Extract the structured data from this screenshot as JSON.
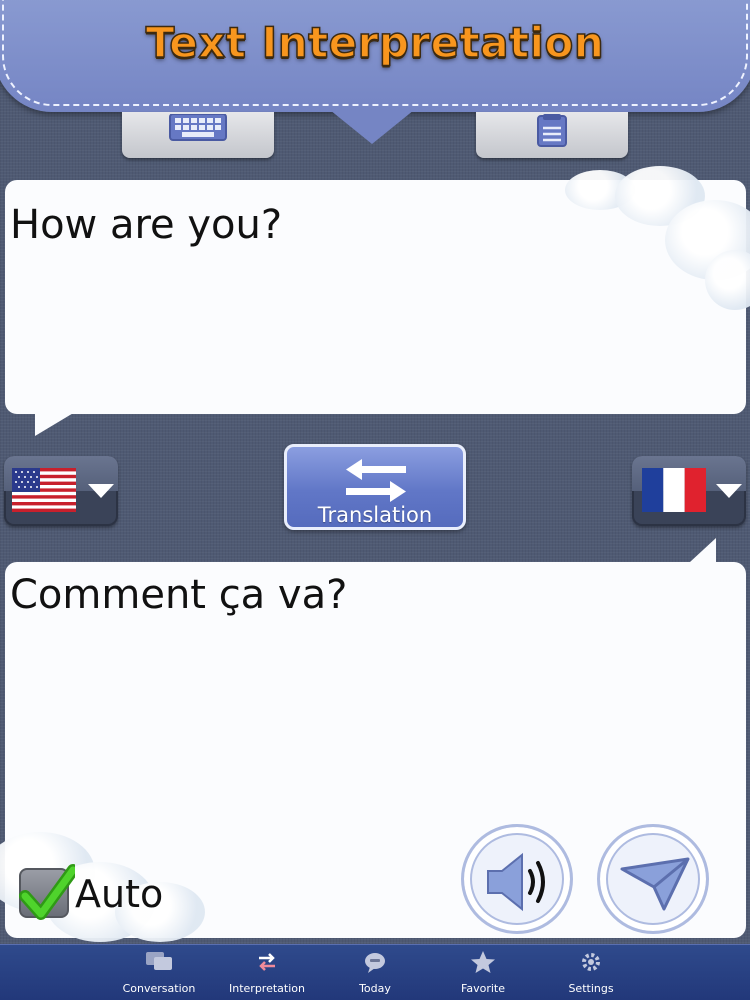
{
  "header": {
    "title": "Text Interpretation"
  },
  "toolbar": {
    "keyboard_icon": "keyboard-icon",
    "paste_icon": "clipboard-icon"
  },
  "source": {
    "text": "How are you?",
    "language_flag": "us-flag-icon"
  },
  "target": {
    "text": "Comment ça va?",
    "language_flag": "france-flag-icon"
  },
  "translate_button": {
    "label": "Translation",
    "icon": "swap-arrows-icon"
  },
  "auto": {
    "label": "Auto",
    "checked": true
  },
  "actions": {
    "speak_icon": "speaker-icon",
    "send_icon": "paper-plane-icon"
  },
  "colors": {
    "title": "#f8961e",
    "banner": "#7f90cc",
    "tabbar": "#2a418a",
    "check": "#38c21e"
  },
  "tabs": [
    {
      "label": "Conversation",
      "icon": "chat-bubbles-icon"
    },
    {
      "label": "Interpretation",
      "icon": "exchange-icon"
    },
    {
      "label": "Today",
      "icon": "speech-bubble-icon"
    },
    {
      "label": "Favorite",
      "icon": "star-icon"
    },
    {
      "label": "Settings",
      "icon": "gear-icon"
    }
  ]
}
